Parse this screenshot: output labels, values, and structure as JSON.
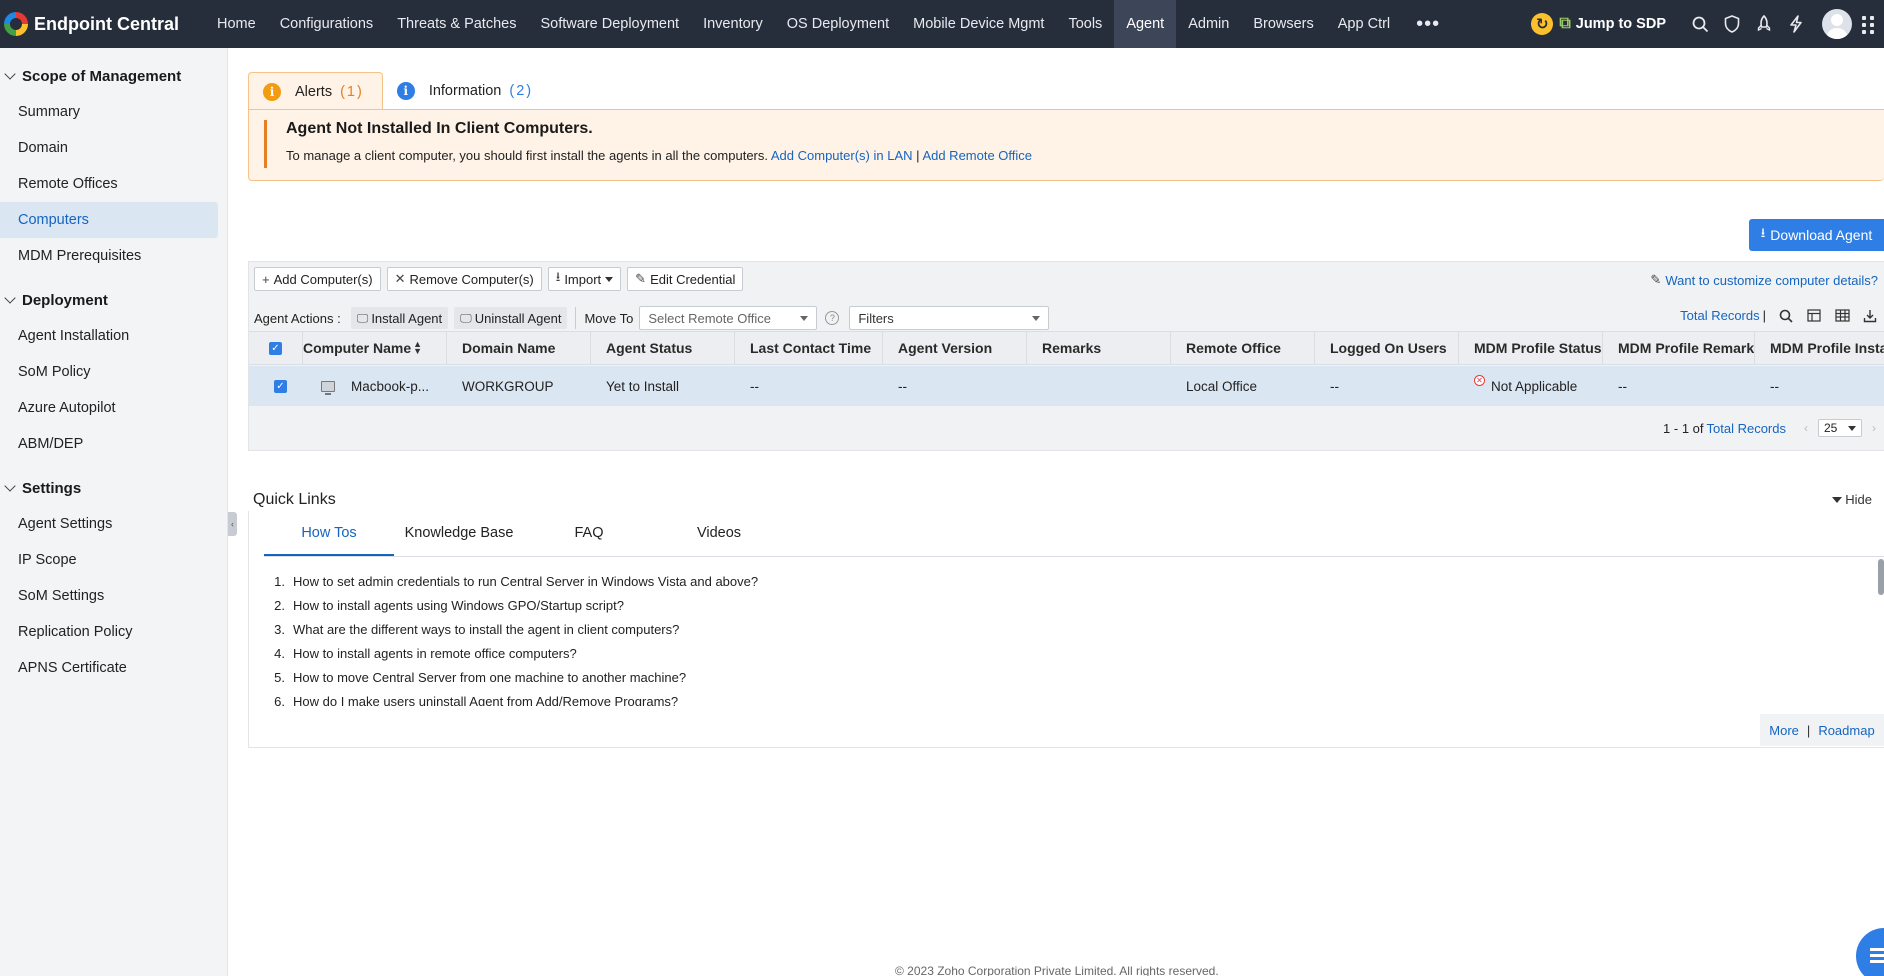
{
  "topbar": {
    "brand": "Endpoint Central",
    "nav": [
      "Home",
      "Configurations",
      "Threats & Patches",
      "Software Deployment",
      "Inventory",
      "OS Deployment",
      "Mobile Device Mgmt",
      "Tools",
      "Agent",
      "Admin",
      "Browsers",
      "App Ctrl"
    ],
    "active_nav": "Agent",
    "jump_label": "Jump to SDP",
    "icons": [
      "refresh-icon",
      "search-icon",
      "shield-icon",
      "rocket-icon",
      "lightning-icon",
      "user-avatar",
      "apps-grid-icon"
    ]
  },
  "sidebar": {
    "sections": [
      {
        "title": "Scope of Management",
        "items": [
          "Summary",
          "Domain",
          "Remote Offices",
          "Computers",
          "MDM Prerequisites"
        ]
      },
      {
        "title": "Deployment",
        "items": [
          "Agent Installation",
          "SoM Policy",
          "Azure Autopilot",
          "ABM/DEP"
        ]
      },
      {
        "title": "Settings",
        "items": [
          "Agent Settings",
          "IP Scope",
          "SoM Settings",
          "Replication Policy",
          "APNS Certificate"
        ]
      }
    ],
    "active_item": "Computers"
  },
  "alerts": {
    "tab_alerts": "Alerts",
    "tab_alerts_count": "(1)",
    "tab_info": "Information",
    "tab_info_count": "(2)",
    "title": "Agent Not Installed In Client Computers.",
    "text": "To manage a client computer, you should first install the agents in all the computers.",
    "link1": "Add Computer(s) in LAN",
    "link_sep": "|",
    "link2": "Add Remote Office"
  },
  "download_agent": "Download Agent",
  "toolbar": {
    "add": "Add Computer(s)",
    "remove": "Remove Computer(s)",
    "import": "Import",
    "edit": "Edit Credential",
    "customize": "Want to customize computer details?",
    "agent_actions": "Agent Actions :",
    "install": "Install Agent",
    "uninstall": "Uninstall Agent",
    "move_to": "Move To",
    "remote_office_placeholder": "Select Remote Office",
    "filters": "Filters",
    "total_records": "Total Records",
    "pipe": "|"
  },
  "table": {
    "columns": [
      "Computer Name",
      "Domain Name",
      "Agent Status",
      "Last Contact Time",
      "Agent Version",
      "Remarks",
      "Remote Office",
      "Logged On Users",
      "MDM Profile Status",
      "MDM Profile Remark",
      "MDM Profile Insta"
    ],
    "rows": [
      [
        "Macbook-p...",
        "WORKGROUP",
        "Yet to Install",
        "--",
        "--",
        "",
        "Local Office",
        "--",
        "Not Applicable",
        "--",
        "--"
      ]
    ],
    "pager_text": "1 - 1 of",
    "pager_link": "Total Records",
    "page_size": "25"
  },
  "quick_links": {
    "title": "Quick Links",
    "hide": "Hide",
    "tabs": [
      "How Tos",
      "Knowledge Base",
      "FAQ",
      "Videos"
    ],
    "active_tab": "How Tos",
    "items": [
      "How to set admin credentials to run Central Server in Windows Vista and above?",
      "How to install agents using Windows GPO/Startup script?",
      "What are the different ways to install the agent in client computers?",
      "How to install agents in remote office computers?",
      "How to move Central Server from one machine to another machine?",
      "How do I make users uninstall Agent from Add/Remove Programs?"
    ],
    "more": "More",
    "sep": "|",
    "roadmap": "Roadmap"
  },
  "footer": "© 2023 Zoho Corporation Private Limited. All rights reserved."
}
